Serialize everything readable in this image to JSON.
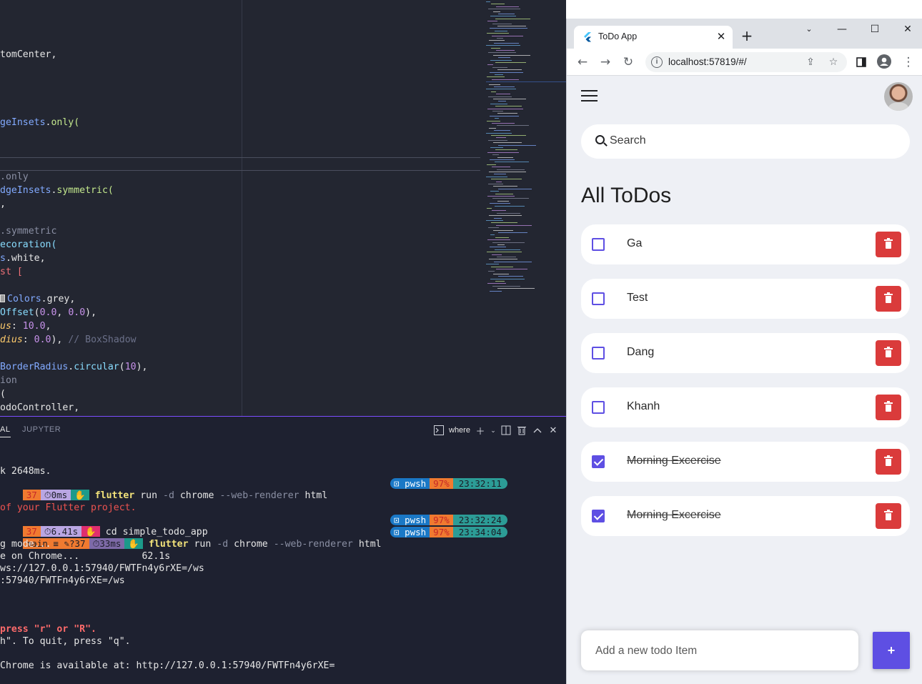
{
  "editor": {
    "lines": [
      {
        "parts": [
          {
            "t": "tomCenter,",
            "c": ""
          }
        ]
      },
      {
        "parts": [
          {
            "t": "geInsets",
            "c": "c-cls"
          },
          {
            "t": ".",
            "c": ""
          },
          {
            "t": "only(",
            "c": "c-grn"
          }
        ]
      },
      {
        "parts": [
          {
            "t": ".only",
            "c": "c-dim"
          }
        ]
      },
      {
        "parts": [
          {
            "t": "dgeInsets",
            "c": "c-cls"
          },
          {
            "t": ".",
            "c": ""
          },
          {
            "t": "symmetric(",
            "c": "c-grn"
          }
        ]
      },
      {
        "parts": [
          {
            "t": ",",
            "c": ""
          }
        ]
      },
      {
        "parts": [
          {
            "t": ".symmetric",
            "c": "c-dim"
          }
        ]
      },
      {
        "parts": [
          {
            "t": "ecoration(",
            "c": "c-fn"
          }
        ]
      },
      {
        "parts": [
          {
            "t": "s",
            "c": "c-cls"
          },
          {
            "t": ".white,",
            "c": ""
          }
        ]
      },
      {
        "parts": [
          {
            "t": "st [",
            "c": "c-kw"
          }
        ]
      },
      {
        "parts": [
          {
            "t": "Colors",
            "c": "c-cls"
          },
          {
            "t": ".grey,",
            "c": ""
          }
        ]
      },
      {
        "parts": [
          {
            "t": "Offset",
            "c": "c-fn"
          },
          {
            "t": "(",
            "c": ""
          },
          {
            "t": "0.0",
            "c": "c-num"
          },
          {
            "t": ", ",
            "c": ""
          },
          {
            "t": "0.0",
            "c": "c-num"
          },
          {
            "t": "),",
            "c": ""
          }
        ]
      },
      {
        "parts": [
          {
            "t": "us",
            "c": "c-prop"
          },
          {
            "t": ": ",
            "c": ""
          },
          {
            "t": "10.0",
            "c": "c-num"
          },
          {
            "t": ",",
            "c": ""
          }
        ]
      },
      {
        "parts": [
          {
            "t": "dius",
            "c": "c-prop"
          },
          {
            "t": ": ",
            "c": ""
          },
          {
            "t": "0.0",
            "c": "c-num"
          },
          {
            "t": "), ",
            "c": ""
          },
          {
            "t": "// BoxShadow",
            "c": "c-cmt"
          }
        ]
      },
      {
        "parts": [
          {
            "t": "BorderRadius",
            "c": "c-cls"
          },
          {
            "t": ".",
            "c": ""
          },
          {
            "t": "circular",
            "c": "c-fn"
          },
          {
            "t": "(",
            "c": ""
          },
          {
            "t": "10",
            "c": "c-num"
          },
          {
            "t": "),",
            "c": ""
          }
        ]
      },
      {
        "parts": [
          {
            "t": "ion",
            "c": "c-dim"
          }
        ]
      },
      {
        "parts": [
          {
            "t": "(",
            "c": ""
          }
        ]
      },
      {
        "parts": [
          {
            "t": "odoController,",
            "c": ""
          }
        ]
      }
    ]
  },
  "terminal": {
    "tabs": {
      "terminal": "AL",
      "jupyter": "JUPYTER"
    },
    "shell_name": "where",
    "lines": {
      "l1": "k 2648ms.",
      "l2_seg1": "37",
      "l2_seg2": "⏱0ms",
      "l2_cmd_a": "flutter",
      "l2_cmd_b": "run",
      "l2_cmd_c": "-d",
      "l2_cmd_d": "chrome",
      "l2_cmd_e": "--web-renderer",
      "l2_cmd_f": "html",
      "l3": "of your Flutter project.",
      "l4_seg1": "37",
      "l4_seg2": "⏱6.41s",
      "l4_cmd": "cd simple_todo_app",
      "l5_seg1": "main ≡ ✎?37",
      "l5_seg2": "⏱33ms",
      "l6": "g mode...",
      "l7": "e on Chrome...           62.1s",
      "l8": "ws://127.0.0.1:57940/FWTFn4y6rXE=/ws",
      "l9": ":57940/FWTFn4y6rXE=/ws",
      "l10": "press \"r\" or \"R\".",
      "l11": "h\". To quit, press \"q\".",
      "l12": "Chrome is available at: http://127.0.0.1:57940/FWTFn4y6rXE="
    },
    "right_prompts": [
      {
        "shell": "pwsh",
        "pct": "97%",
        "time": "23:32:11"
      },
      {
        "shell": "pwsh",
        "pct": "97%",
        "time": "23:32:24"
      },
      {
        "shell": "pwsh",
        "pct": "97%",
        "time": "23:34:04"
      }
    ]
  },
  "browser": {
    "tab_title": "ToDo App",
    "url": "localhost:57819/#/",
    "icons": [
      "back-arrow-icon",
      "forward-arrow-icon",
      "reload-icon",
      "info-icon",
      "share-icon",
      "star-icon",
      "side-panel-icon",
      "profile-icon",
      "more-icon"
    ]
  },
  "app": {
    "search_placeholder": "Search",
    "heading": "All ToDos",
    "todos": [
      {
        "text": "Ga",
        "done": false
      },
      {
        "text": "Test",
        "done": false
      },
      {
        "text": "Dang",
        "done": false
      },
      {
        "text": "Khanh",
        "done": false
      },
      {
        "text": "Morning Excercise",
        "done": true
      },
      {
        "text": "Morning Excercise",
        "done": true
      }
    ],
    "add_placeholder": "Add a new todo Item",
    "add_button": "+"
  },
  "colors": {
    "accent": "#5e4fe3",
    "delete": "#da3b3b",
    "app_bg": "#eef0f5",
    "editor_bg": "#232631"
  }
}
